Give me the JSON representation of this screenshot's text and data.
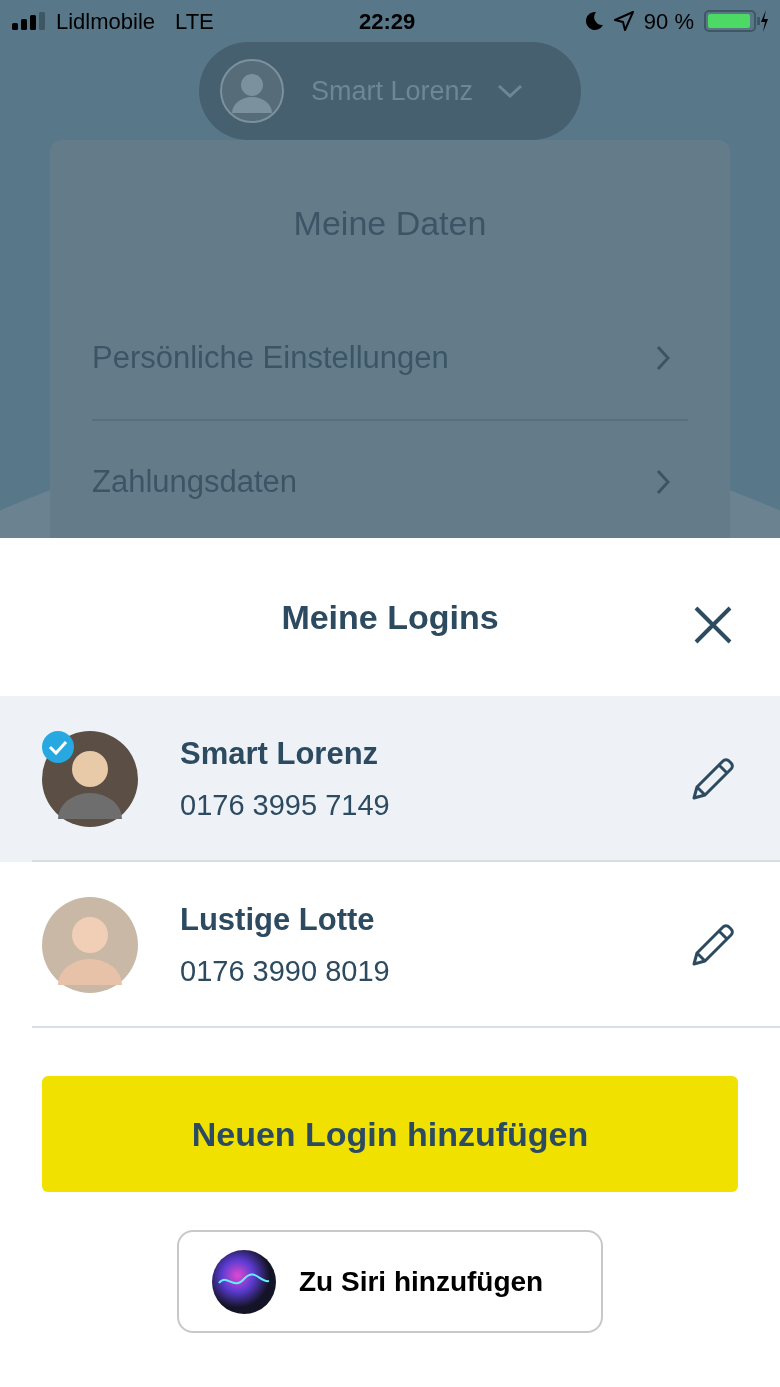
{
  "status_bar": {
    "carrier": "Lidlmobile",
    "network": "LTE",
    "time": "22:29",
    "battery": "90 %"
  },
  "profile_switcher": {
    "name": "Smart Lorenz"
  },
  "card": {
    "title": "Meine Daten",
    "items": [
      {
        "label": "Persönliche Einstellungen"
      },
      {
        "label": "Zahlungsdaten"
      }
    ]
  },
  "sheet": {
    "title": "Meine Logins",
    "logins": [
      {
        "name": "Smart Lorenz",
        "phone": "0176 3995 7149",
        "selected": true
      },
      {
        "name": "Lustige Lotte",
        "phone": "0176 3990 8019",
        "selected": false
      }
    ],
    "add_button": "Neuen Login hinzufügen",
    "siri_button": "Zu Siri hinzufügen"
  }
}
